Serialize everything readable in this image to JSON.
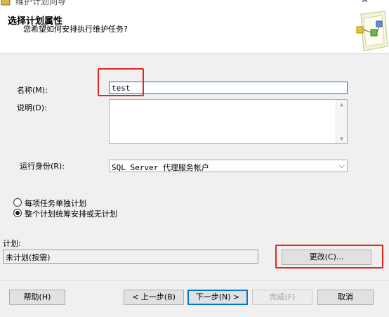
{
  "window": {
    "title": "维护计划向导"
  },
  "header": {
    "title": "选择计划属性",
    "subtitle": "您希望如何安排执行维护任务?"
  },
  "form": {
    "name_label": "名称(M):",
    "name_value": "test",
    "description_label": "说明(D):",
    "description_value": "",
    "run_as_label": "运行身份(R):",
    "run_as_value": "SQL Server 代理服务帐户"
  },
  "schedule_options": [
    {
      "label": "每项任务单独计划",
      "checked": false
    },
    {
      "label": "整个计划统筹安排或无计划",
      "checked": true
    }
  ],
  "schedule": {
    "label": "计划:",
    "value": "未计划(按需)",
    "change_label": "更改(C)..."
  },
  "footer": {
    "help_label": "帮助(H)",
    "back_label": "< 上一步(B)",
    "next_label": "下一步(N) >",
    "finish_label": "完成(F)",
    "cancel_label": "取消"
  },
  "icons": {
    "window_icon": "maintenance-plan-icon",
    "header_graphic": "wizard-header-graphic",
    "close": "close-icon",
    "dropdown": "chevron-down-icon"
  },
  "colors": {
    "accent": "#0078d7",
    "highlight": "#e3261f",
    "dialog_bg": "#f0f0f0"
  }
}
